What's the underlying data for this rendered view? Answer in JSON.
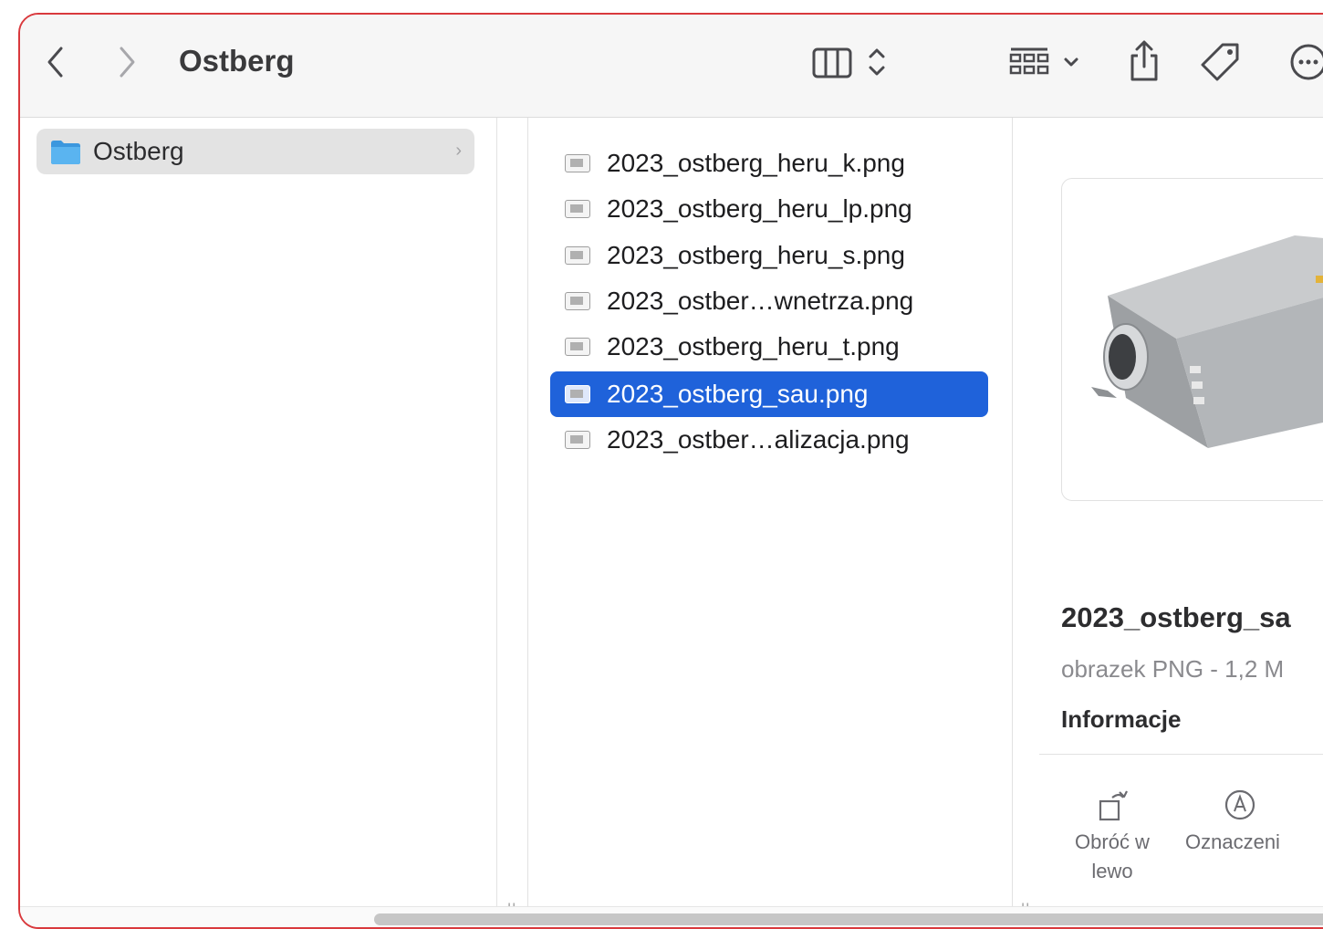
{
  "toolbar": {
    "title": "Ostberg",
    "back_icon": "chevron-left-icon",
    "forward_icon": "chevron-right-icon",
    "view_icon": "column-view-icon",
    "group_icon": "group-grid-icon",
    "share_icon": "share-icon",
    "tag_icon": "tag-icon",
    "more_icon": "ellipsis-circle-icon"
  },
  "sidebar": {
    "items": [
      {
        "label": "Ostberg",
        "icon": "folder-icon"
      }
    ]
  },
  "files": [
    {
      "name": "2023_ostberg_heru_k.png",
      "selected": false
    },
    {
      "name": "2023_ostberg_heru_lp.png",
      "selected": false
    },
    {
      "name": "2023_ostberg_heru_s.png",
      "selected": false
    },
    {
      "name": "2023_ostber…wnetrza.png",
      "selected": false
    },
    {
      "name": "2023_ostberg_heru_t.png",
      "selected": false
    },
    {
      "name": "2023_ostberg_sau.png",
      "selected": true
    },
    {
      "name": "2023_ostber…alizacja.png",
      "selected": false
    }
  ],
  "preview": {
    "file_name": "2023_ostberg_sa",
    "kind": "obrazek PNG - 1,2 M",
    "info_heading": "Informacje",
    "actions": [
      {
        "label_line1": "Obróć w",
        "label_line2": "lewo",
        "icon": "rotate-left-icon"
      },
      {
        "label_line1": "Oznaczeni",
        "label_line2": "",
        "icon": "markup-icon"
      }
    ]
  },
  "colors": {
    "selection": "#1f62da",
    "window_border": "#d9393d",
    "folder": "#4aa8e8"
  }
}
